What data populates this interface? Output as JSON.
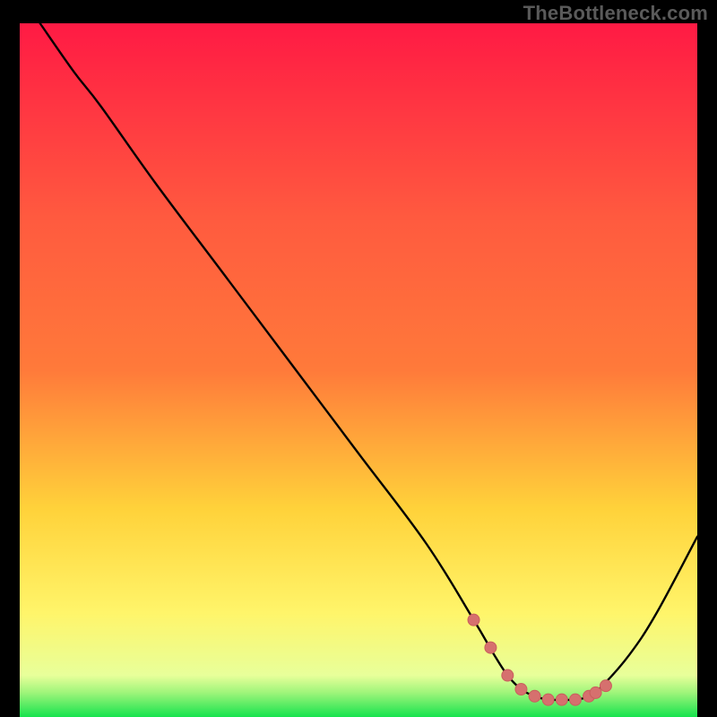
{
  "watermark": "TheBottleneck.com",
  "colors": {
    "black": "#000000",
    "curve": "#000000",
    "marker_fill": "#d6706e",
    "marker_stroke": "#c95f5d",
    "grad_top": "#ff1a44",
    "grad_mid_top": "#ff7a3a",
    "grad_mid": "#ffd23a",
    "grad_mid_low": "#fff56a",
    "grad_low": "#e8ff9a",
    "grad_bottom": "#17e34e"
  },
  "chart_data": {
    "type": "line",
    "title": "",
    "xlabel": "",
    "ylabel": "",
    "xlim": [
      0,
      100
    ],
    "ylim": [
      0,
      100
    ],
    "series": [
      {
        "name": "bottleneck-curve",
        "x": [
          3,
          8,
          12,
          20,
          30,
          40,
          50,
          60,
          67,
          70,
          72,
          74,
          76,
          78,
          80,
          82,
          84,
          86,
          90,
          94,
          100
        ],
        "y": [
          100,
          93,
          88,
          77,
          64,
          51,
          38,
          25,
          14,
          9,
          6,
          4,
          3,
          2.5,
          2.5,
          2.5,
          3,
          4.5,
          9,
          15,
          26
        ]
      }
    ],
    "markers": {
      "name": "optimal-range",
      "x": [
        67,
        69.5,
        72,
        74,
        76,
        78,
        80,
        82,
        84,
        85,
        86.5
      ],
      "y": [
        14,
        10,
        6,
        4,
        3,
        2.5,
        2.5,
        2.5,
        3,
        3.5,
        4.5
      ]
    },
    "gradient_band": {
      "green_start_y": 3.5,
      "green_end_y": 0
    }
  }
}
